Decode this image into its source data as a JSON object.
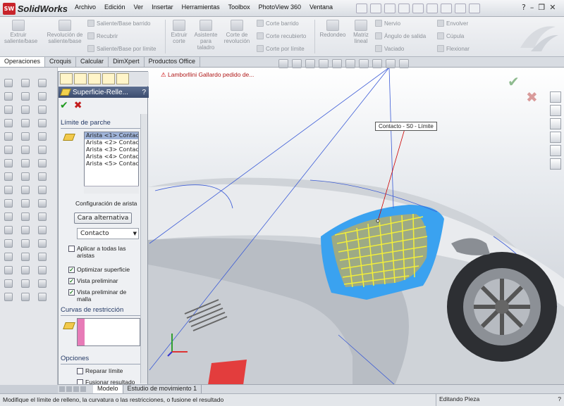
{
  "app": {
    "brand": "SolidWorks"
  },
  "menu": [
    "Archivo",
    "Edición",
    "Ver",
    "Insertar",
    "Herramientas",
    "Toolbox",
    "PhotoView 360",
    "Ventana"
  ],
  "ribbon": {
    "big": [
      "Extruir saliente/base",
      "Revolución de saliente/base",
      "Extruir corte",
      "Asistente para taladro",
      "Corte de revolución",
      "Redondeo",
      "Matriz lineal"
    ],
    "small_col1": [
      "Saliente/Base barrido",
      "Recubrir",
      "Saliente/Base por límite"
    ],
    "small_col2": [
      "Corte barrido",
      "Corte recubierto",
      "Corte por límite"
    ],
    "small_col3": [
      "Nervio",
      "Ángulo de salida",
      "Vaciado"
    ],
    "small_col4": [
      "Envolver",
      "Cúpula",
      "Flexionar"
    ]
  },
  "tabs": [
    "Operaciones",
    "Croquis",
    "Calcular",
    "DimXpert",
    "Productos Office"
  ],
  "tree_item": "Lamborllini Gallardo pedido de...",
  "panel": {
    "title": "Superficie-Relle...",
    "section1": "Límite de parche",
    "edges": [
      "Arista <1> Contact",
      "Arista <2> Contact",
      "Arista <3> Contact",
      "Arista <4> Contact",
      "Arista <5> Contact"
    ],
    "edge_config": "Configuración de arista",
    "alt_face": "Cara alternativa",
    "dropdown": "Contacto",
    "checks": [
      {
        "label": "Aplicar a todas las aristas",
        "checked": false
      },
      {
        "label": "Optimizar superficie",
        "checked": true
      },
      {
        "label": "Vista preliminar",
        "checked": true
      },
      {
        "label": "Vista preliminar de malla",
        "checked": true
      }
    ],
    "section2": "Curvas de restricción",
    "section3": "Opciones",
    "options": [
      {
        "label": "Reparar límite",
        "checked": false
      },
      {
        "label": "Fusionar resultado",
        "checked": false
      }
    ]
  },
  "callout": "Contacto - S0 - Límite",
  "bottom_tabs": [
    "Modelo",
    "Estudio de movimiento 1"
  ],
  "status": "Modifique el límite de relleno, la curvatura o las restricciones, o fusione el resultado",
  "status_right": "Editando Pieza",
  "colors": {
    "patch": "#2b8de0",
    "grid": "#f2ee3a",
    "title": "#3c4d6f",
    "pink": "#e77bb7",
    "red": "#e33d3d"
  }
}
